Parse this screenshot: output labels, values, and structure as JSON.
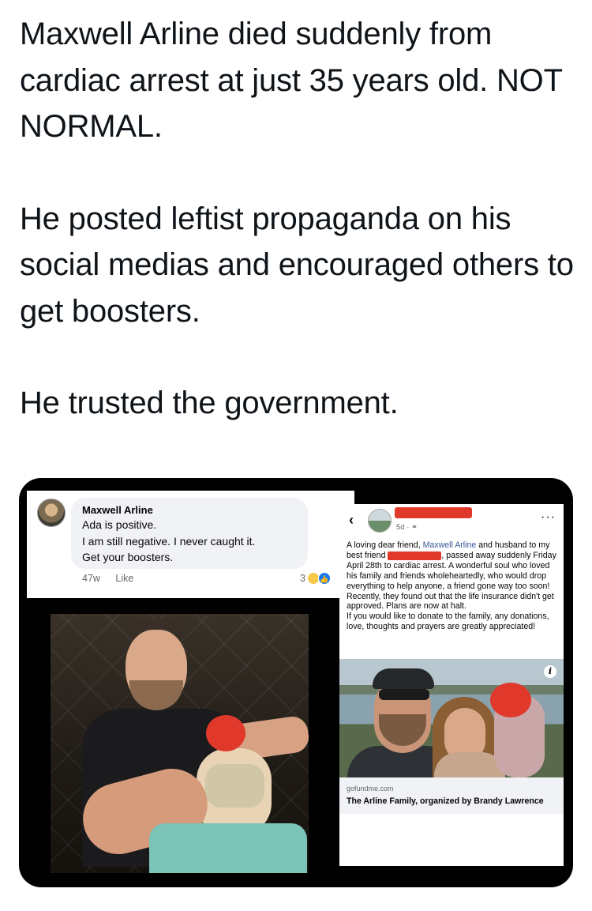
{
  "tweet": {
    "paragraphs": [
      "Maxwell Arline died suddenly from cardiac arrest at just 35 years old. NOT NORMAL.",
      "He posted leftist propaganda on his social medias and encouraged others to get boosters.",
      "He trusted the government."
    ]
  },
  "comment": {
    "author": "Maxwell Arline",
    "lines": [
      "Ada is positive.",
      "I am still negative. I never caught it.",
      "Get your boosters."
    ],
    "time": "47w",
    "like_label": "Like",
    "reaction_count": "3",
    "reaction_icons": [
      "care-emoji-icon",
      "like-reaction-icon"
    ]
  },
  "post": {
    "time": "5d",
    "privacy_icon": "globe-icon",
    "body_intro": "A loving dear friend,",
    "body_link": "Maxwell Arline",
    "body_after_link": "and husband to my best friend",
    "body_rest": ", passed away suddenly Friday April 28th to cardiac arrest. A wonderful soul who loved his family and friends wholeheartedly, who would drop everything to help anyone, a friend gone way too soon!",
    "body_p2": "Recently, they found out that the life insurance didn't get approved. Plans are now at halt.",
    "body_p3": "If you would like to donate to the family, any donations, love, thoughts and prayers are greatly appreciated!",
    "link_domain": "gofundme.com",
    "link_title": "The Arline Family, organized by Brandy Lawrence"
  },
  "colors": {
    "link_blue": "#385898",
    "redaction_red": "#e0392b",
    "media_bg": "#000000"
  }
}
